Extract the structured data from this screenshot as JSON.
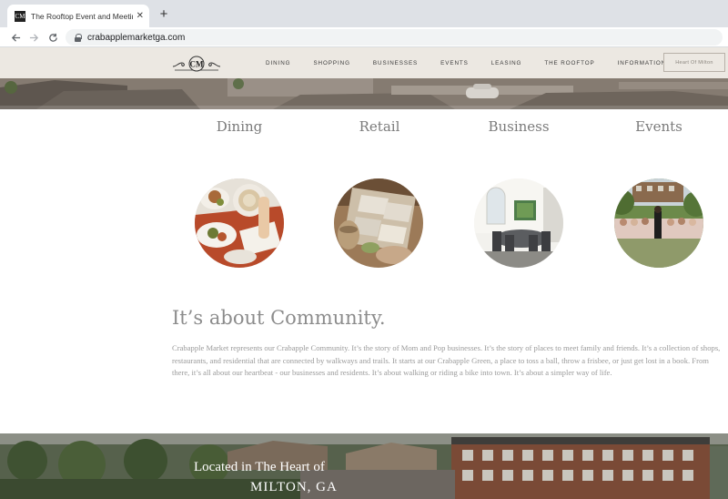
{
  "browser": {
    "tab_title": "The Rooftop Event and Meeting Spa",
    "favicon_text": "CM",
    "url": "crabapplemarketga.com",
    "icons": [
      "back-arrow-icon",
      "forward-arrow-icon",
      "reload-icon",
      "lock-icon",
      "close-icon",
      "plus-icon"
    ]
  },
  "header": {
    "logo_text": "CM",
    "nav": [
      "DINING",
      "SHOPPING",
      "BUSINESSES",
      "EVENTS",
      "LEASING",
      "THE ROOFTOP",
      "INFORMATION"
    ],
    "cta_label": "Heart Of Milton"
  },
  "categories": [
    {
      "label": "Dining"
    },
    {
      "label": "Retail"
    },
    {
      "label": "Business"
    },
    {
      "label": "Events"
    }
  ],
  "community": {
    "title": "It’s about Community.",
    "body": "Crabapple Market represents our Crabapple Community. It’s the story of Mom and Pop businesses. It’s the story of places to meet family and friends. It’s a collection of shops, restaurants, and residential that are connected by walkways and trails. It starts at our Crabapple Green, a place to toss a ball, throw a frisbee, or just get lost in a book. From there, it’s all about our heartbeat - our businesses and residents. It’s about walking or riding a bike into town. It’s about a simpler way of life."
  },
  "banner": {
    "line1": "Located in The Heart of",
    "line2": "MILTON, GA"
  },
  "colors": {
    "header_bg": "#ece8e2",
    "heading_gray": "#7a7a7a",
    "body_gray": "#9a9a9a"
  }
}
